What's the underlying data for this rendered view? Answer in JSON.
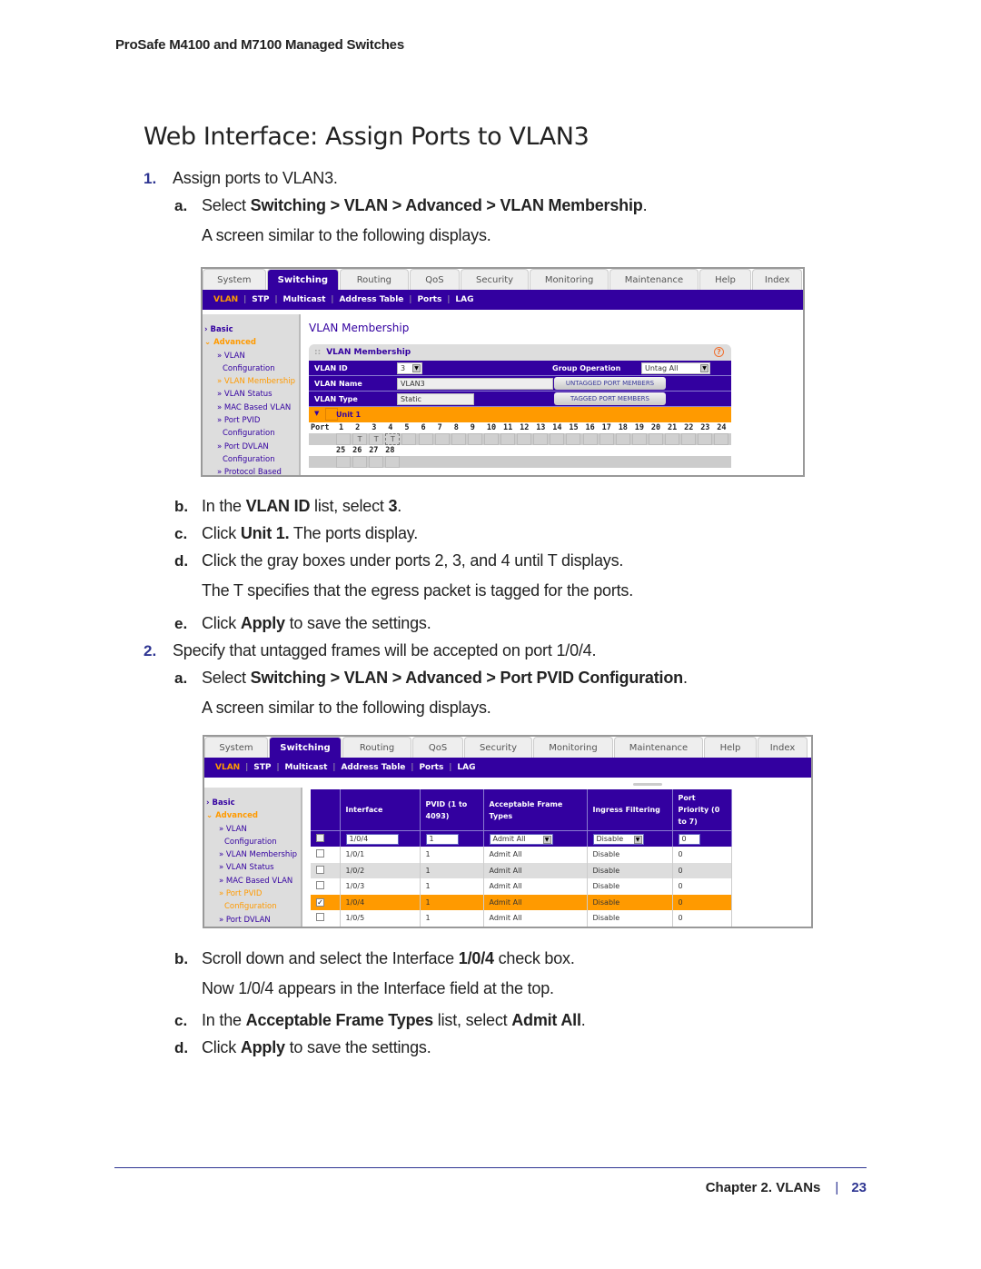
{
  "running_head": "ProSafe M4100 and M7100 Managed Switches",
  "page_title": "Web Interface: Assign Ports to VLAN3",
  "steps": [
    {
      "num": "1.",
      "text": "Assign ports to VLAN3.",
      "substeps": [
        {
          "letter": "a.",
          "pre": "Select ",
          "bold": "Switching > VLAN > Advanced > VLAN Membership",
          "post": ".",
          "note": "A screen similar to the following displays."
        },
        {
          "letter": "b.",
          "pre": "In the ",
          "bold": "VLAN ID",
          "mid": " list, select ",
          "bold2": "3",
          "post": "."
        },
        {
          "letter": "c.",
          "pre": "Click ",
          "bold": "Unit 1.",
          "post": " The ports display."
        },
        {
          "letter": "d.",
          "text": "Click the gray boxes under ports 2, 3, and 4 until T displays.",
          "note": "The T specifies that the egress packet is tagged for the ports."
        },
        {
          "letter": "e.",
          "pre": "Click ",
          "bold": "Apply",
          "post": " to save the settings."
        }
      ]
    },
    {
      "num": "2.",
      "text": "Specify that untagged frames will be accepted on port 1/0/4.",
      "substeps": [
        {
          "letter": "a.",
          "pre": "Select ",
          "bold": "Switching > VLAN > Advanced > Port PVID Configuration",
          "post": ".",
          "note": "A screen similar to the following displays."
        },
        {
          "letter": "b.",
          "pre": "Scroll down and select the Interface ",
          "bold": "1/0/4",
          "post": " check box.",
          "note": "Now 1/0/4 appears in the Interface field at the top."
        },
        {
          "letter": "c.",
          "pre": "In the ",
          "bold": "Acceptable Frame Types",
          "mid": " list, select ",
          "bold2": "Admit All",
          "post": "."
        },
        {
          "letter": "d.",
          "pre": "Click ",
          "bold": "Apply",
          "post": " to save the settings."
        }
      ]
    }
  ],
  "ui": {
    "tabs": [
      "System",
      "Switching",
      "Routing",
      "QoS",
      "Security",
      "Monitoring",
      "Maintenance",
      "Help",
      "Index"
    ],
    "active_tab": "Switching",
    "subnav": [
      "VLAN",
      "STP",
      "Multicast",
      "Address Table",
      "Ports",
      "LAG"
    ],
    "active_subnav": "VLAN",
    "sidebar": [
      "Basic",
      "Advanced",
      "» VLAN",
      "Configuration",
      "» VLAN Membership",
      "» VLAN Status",
      "» MAC Based VLAN",
      "» Port PVID",
      "Configuration",
      "» Port DVLAN",
      "Configuration",
      "» Protocol Based"
    ],
    "colors": {
      "primary": "#3300a0",
      "accent": "#ff9a00",
      "link": "#2e3592"
    }
  },
  "screen1": {
    "content_title": "VLAN Membership",
    "panel_title": "VLAN Membership",
    "vlan_id_label": "VLAN ID",
    "vlan_id_value": "3",
    "vlan_name_label": "VLAN Name",
    "vlan_name_value": "VLAN3",
    "vlan_type_label": "VLAN Type",
    "vlan_type_value": "Static",
    "group_operation_label": "Group Operation",
    "group_operation_value": "Untag All",
    "untagged_button": "UNTAGGED PORT MEMBERS",
    "tagged_button": "TAGGED PORT MEMBERS",
    "unit_label": "Unit 1",
    "port_label": "Port",
    "ports_row1": [
      "1",
      "2",
      "3",
      "4",
      "5",
      "6",
      "7",
      "8",
      "9",
      "10",
      "11",
      "12",
      "13",
      "14",
      "15",
      "16",
      "17",
      "18",
      "19",
      "20",
      "21",
      "22",
      "23",
      "24"
    ],
    "ports_row1_marks": [
      "",
      "T",
      "T",
      "T",
      "",
      "",
      "",
      "",
      "",
      "",
      "",
      "",
      "",
      "",
      "",
      "",
      "",
      "",
      "",
      "",
      "",
      "",
      "",
      ""
    ],
    "ports_row2": [
      "25",
      "26",
      "27",
      "28"
    ],
    "ports_row2_marks": [
      "",
      "",
      "",
      ""
    ]
  },
  "screen2": {
    "columns": [
      "Interface",
      "PVID (1 to 4093)",
      "Acceptable Frame Types",
      "Ingress Filtering",
      "Port Priority (0 to 7)"
    ],
    "edit_row": {
      "interface": "1/0/4",
      "pvid": "1",
      "frame_types": "Admit All",
      "ingress": "Disable",
      "priority": "0"
    },
    "rows": [
      {
        "checked": false,
        "interface": "1/0/1",
        "pvid": "1",
        "frame_types": "Admit All",
        "ingress": "Disable",
        "priority": "0"
      },
      {
        "checked": false,
        "interface": "1/0/2",
        "pvid": "1",
        "frame_types": "Admit All",
        "ingress": "Disable",
        "priority": "0"
      },
      {
        "checked": false,
        "interface": "1/0/3",
        "pvid": "1",
        "frame_types": "Admit All",
        "ingress": "Disable",
        "priority": "0"
      },
      {
        "checked": true,
        "interface": "1/0/4",
        "pvid": "1",
        "frame_types": "Admit All",
        "ingress": "Disable",
        "priority": "0"
      },
      {
        "checked": false,
        "interface": "1/0/5",
        "pvid": "1",
        "frame_types": "Admit All",
        "ingress": "Disable",
        "priority": "0"
      }
    ]
  },
  "footer": {
    "chapter": "Chapter 2.  VLANs",
    "page": "23"
  }
}
